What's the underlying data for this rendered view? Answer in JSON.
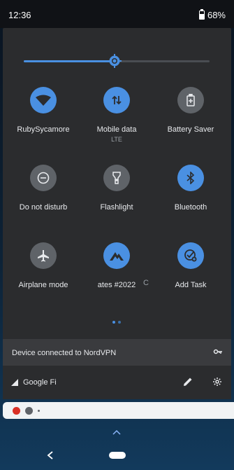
{
  "status": {
    "time": "12:36",
    "battery": "68%"
  },
  "brightness": {
    "level": 0.49
  },
  "tiles": [
    {
      "label": "RubySycamore",
      "sub": "",
      "icon": "wifi-icon",
      "state": "on"
    },
    {
      "label": "Mobile data",
      "sub": "LTE",
      "icon": "mobile-data-icon",
      "state": "on"
    },
    {
      "label": "Battery Saver",
      "sub": "",
      "icon": "battery-saver-icon",
      "state": "off"
    },
    {
      "label": "Do not disturb",
      "sub": "",
      "icon": "do-not-disturb-icon",
      "state": "off"
    },
    {
      "label": "Flashlight",
      "sub": "",
      "icon": "flashlight-icon",
      "state": "off"
    },
    {
      "label": "Bluetooth",
      "sub": "",
      "icon": "bluetooth-icon",
      "state": "on"
    },
    {
      "label": "Airplane mode",
      "sub": "",
      "icon": "airplane-icon",
      "state": "off"
    },
    {
      "label": "ates #2022",
      "sub": "",
      "icon": "nordvpn-icon",
      "state": "on"
    },
    {
      "label": "Add Task",
      "sub": "",
      "icon": "add-task-icon",
      "state": "on"
    }
  ],
  "overflow_fragment": "C",
  "vpn": {
    "text": "Device connected to NordVPN"
  },
  "footer": {
    "carrier": "Google Fi"
  },
  "colors": {
    "accent": "#4a90e2",
    "tile_off": "#5f6368",
    "panel": "#2b2c2e"
  }
}
